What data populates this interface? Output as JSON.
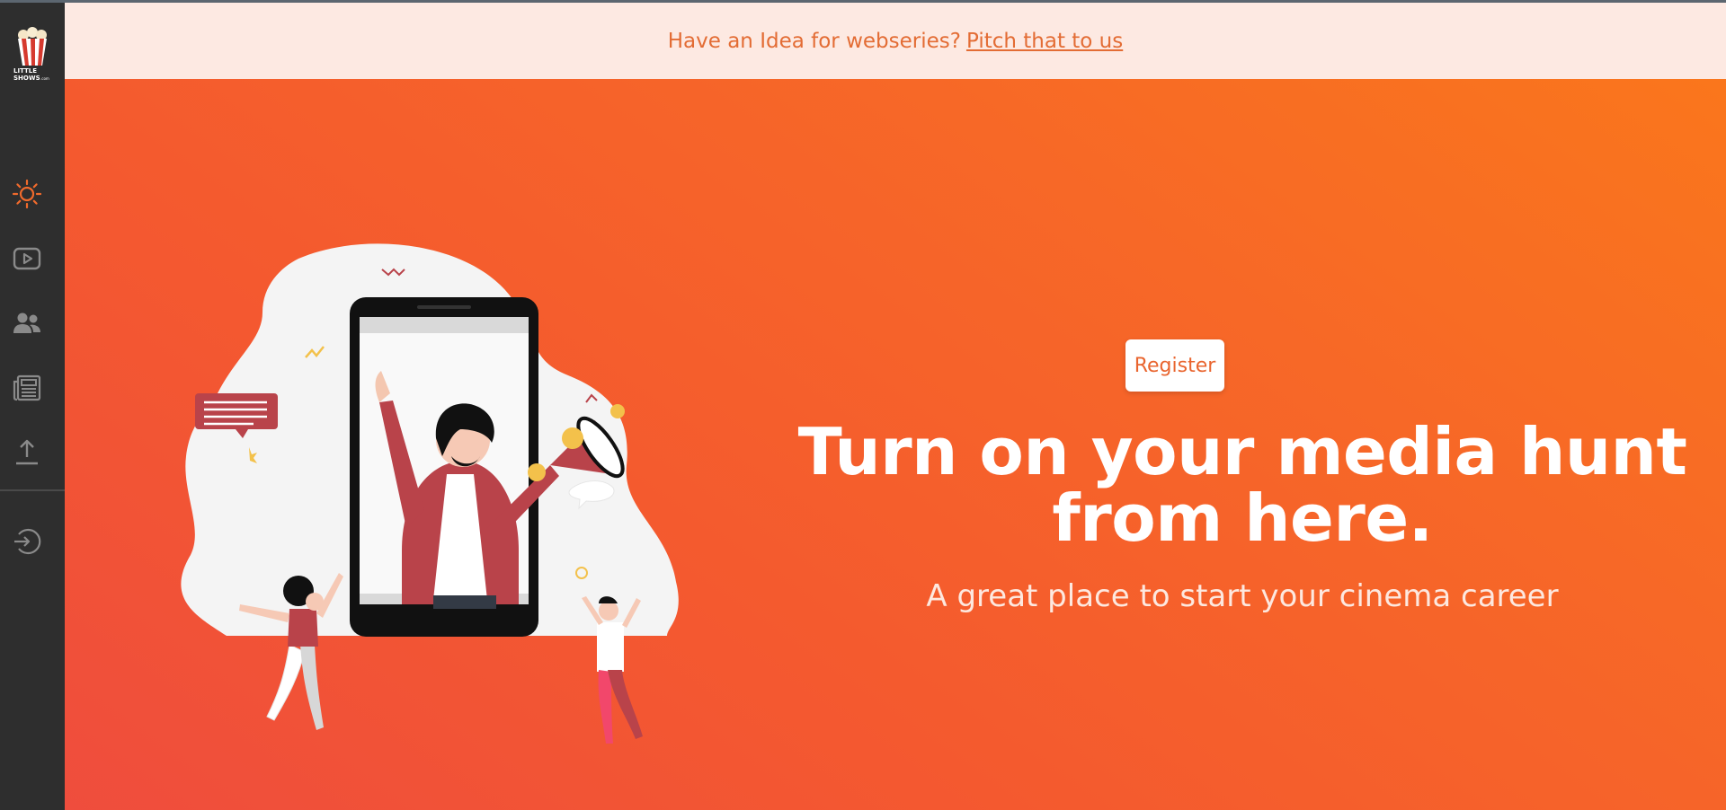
{
  "announcement": {
    "text": "Have an Idea for webseries?",
    "link_label": "Pitch that to us"
  },
  "sidebar": {
    "logo_text": "LITTLE SHOWS.com",
    "items": [
      {
        "icon": "sun-icon",
        "active": true
      },
      {
        "icon": "play-icon",
        "active": false
      },
      {
        "icon": "users-icon",
        "active": false
      },
      {
        "icon": "news-icon",
        "active": false
      },
      {
        "icon": "upload-icon",
        "active": false
      },
      {
        "icon": "login-icon",
        "active": false
      }
    ]
  },
  "hero": {
    "register_label": "Register",
    "headline_line1": "Turn on your media hunt",
    "headline_line2": "from here.",
    "subheadline": "A great place to start your cinema career"
  },
  "colors": {
    "accent": "#f4662b",
    "sidebar_bg": "#2e2e2e",
    "announce_bg": "#fde9e2",
    "gradient_start": "#ef4d3d",
    "gradient_end": "#fa761c"
  }
}
